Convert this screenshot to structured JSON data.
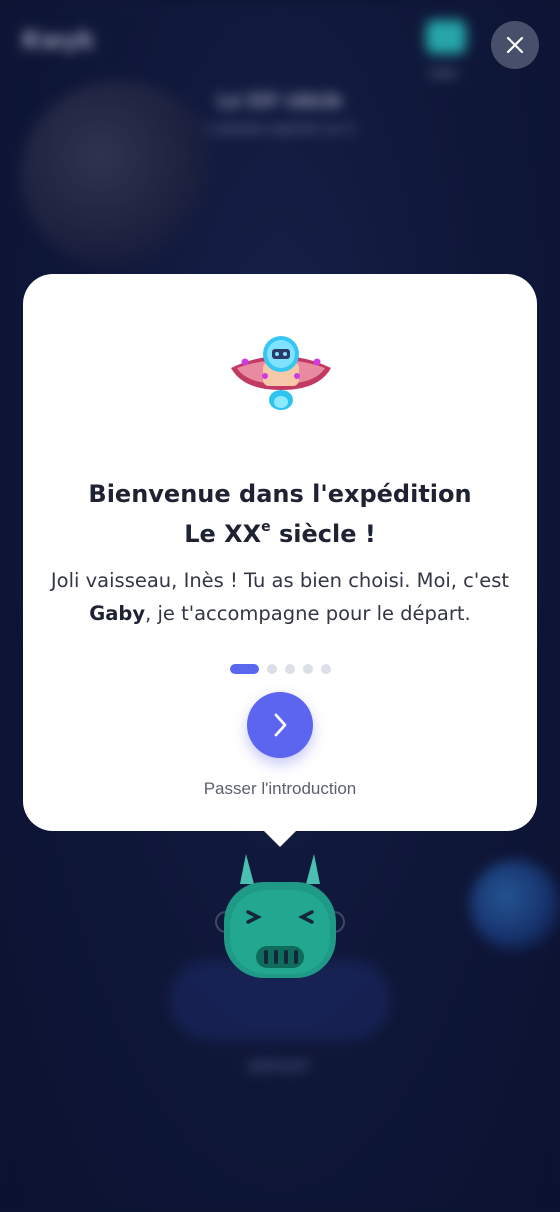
{
  "background": {
    "logo": "Kwyk",
    "video_label": "Vidéo",
    "expedition_title": "Le XXᵉ siècle",
    "expedition_subtitle": "1 planète explorée sur 5",
    "depart_label": "DÉPART"
  },
  "modal": {
    "title_line1": "Bienvenue dans l'expédition",
    "title_line2_prefix": "Le XX",
    "title_line2_sup": "e",
    "title_line2_suffix": " siècle !",
    "body_part1": "Joli vaisseau, Inès ! Tu as bien choisi. Moi, c'est ",
    "body_bold": "Gaby",
    "body_part2": ", je t'accompagne pour le départ.",
    "skip_label": "Passer l'introduction",
    "steps_total": 5,
    "step_current": 1
  },
  "colors": {
    "accent": "#5b65f0",
    "background": "#0d1433",
    "card": "#ffffff",
    "mascot": "#1f9a86"
  },
  "icons": {
    "close": "close-icon",
    "next": "chevron-right-icon",
    "ship": "spaceship-icon",
    "mascot": "robot-mascot"
  }
}
